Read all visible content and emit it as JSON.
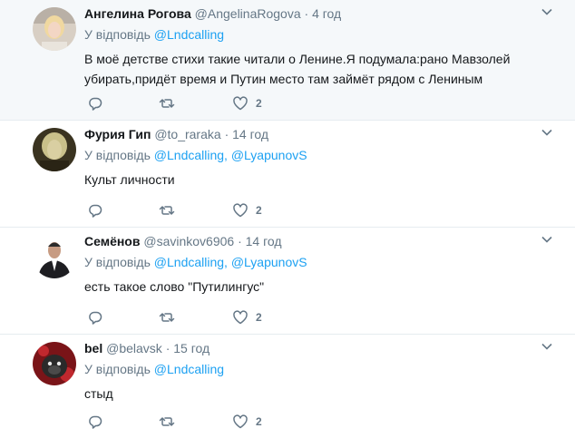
{
  "reply_prefix": "У відповідь",
  "colors": {
    "link": "#1da1f2",
    "secondary": "#657786",
    "text": "#14171a",
    "hover_bg": "#f5f8fa"
  },
  "tweets": [
    {
      "name": "Ангелина Рогова",
      "handle": "@AngelinaRogova",
      "dot": "·",
      "time": "4 год",
      "mentions": [
        "@Lndcalling"
      ],
      "text": "В моё детстве стихи такие читали о Ленине.Я подумала:рано Мавзолей убирать,придёт время и Путин место там займёт рядом с Лениным",
      "reply_count": "",
      "retweet_count": "",
      "like_count": "2"
    },
    {
      "name": "Фурия Гип",
      "handle": "@to_raraka",
      "dot": "·",
      "time": "14 год",
      "mentions": [
        "@Lndcalling",
        "@LyapunovS"
      ],
      "text": "Культ личности",
      "reply_count": "",
      "retweet_count": "",
      "like_count": "2"
    },
    {
      "name": "Семёнов",
      "handle": "@savinkov6906",
      "dot": "·",
      "time": "14 год",
      "mentions": [
        "@Lndcalling",
        "@LyapunovS"
      ],
      "text": "есть такое слово \"Путилингус\"",
      "reply_count": "",
      "retweet_count": "",
      "like_count": "2"
    },
    {
      "name": "bel",
      "handle": "@belavsk",
      "dot": "·",
      "time": "15 год",
      "mentions": [
        "@Lndcalling"
      ],
      "text": "стыд",
      "reply_count": "",
      "retweet_count": "",
      "like_count": "2"
    }
  ]
}
